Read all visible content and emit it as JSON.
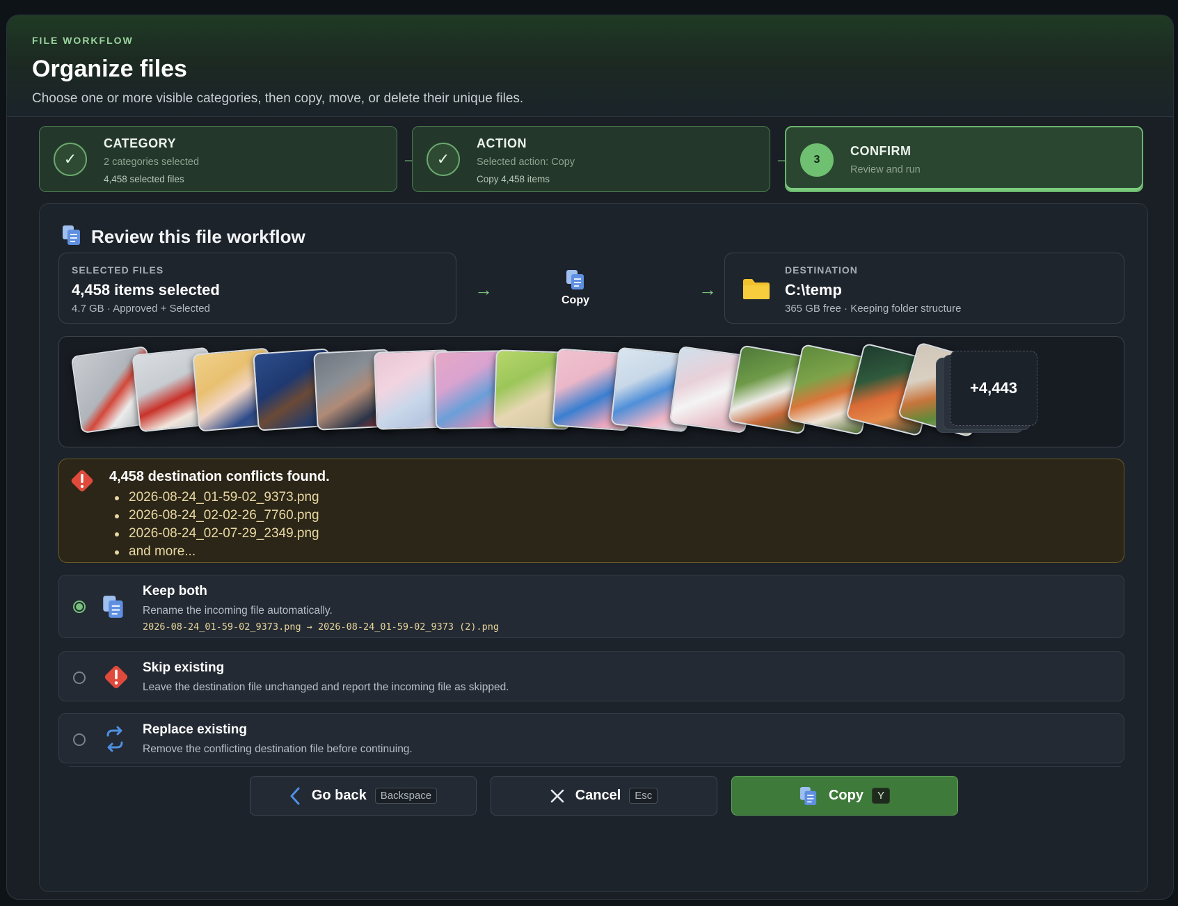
{
  "header": {
    "eyebrow": "FILE WORKFLOW",
    "title": "Organize files",
    "subtitle": "Choose one or more visible categories, then copy, move, or delete their unique files."
  },
  "steps": [
    {
      "title": "CATEGORY",
      "line1": "2 categories selected",
      "line2": "4,458 selected files",
      "marker": "✓",
      "state": "done"
    },
    {
      "title": "ACTION",
      "line1": "Selected action: Copy",
      "line2": "Copy 4,458 items",
      "marker": "✓",
      "state": "done"
    },
    {
      "title": "CONFIRM",
      "line1": "Review and run",
      "marker": "3",
      "state": "active"
    }
  ],
  "review": {
    "heading": "Review this file workflow",
    "selected": {
      "label": "SELECTED FILES",
      "value": "4,458 items selected",
      "meta": "4.7 GB · Approved + Selected"
    },
    "action": {
      "label": "Copy",
      "icon": "copy-icon"
    },
    "destination": {
      "label": "DESTINATION",
      "value": "C:\\temp",
      "meta": "365 GB free · Keeping folder structure",
      "icon": "folder-icon"
    },
    "more_count": "+4,443"
  },
  "conflicts": {
    "heading": "4,458 destination conflicts found.",
    "items": [
      "2026-08-24_01-59-02_9373.png",
      "2026-08-24_02-02-26_7760.png",
      "2026-08-24_02-07-29_2349.png",
      "and more..."
    ]
  },
  "options": [
    {
      "title": "Keep both",
      "desc": "Rename the incoming file automatically.",
      "example": "2026-08-24_01-59-02_9373.png → 2026-08-24_01-59-02_9373 (2).png",
      "selected": true,
      "icon": "copy-icon"
    },
    {
      "title": "Skip existing",
      "desc": "Leave the destination file unchanged and report the incoming file as skipped.",
      "selected": false,
      "icon": "warning-icon"
    },
    {
      "title": "Replace existing",
      "desc": "Remove the conflicting destination file before continuing.",
      "selected": false,
      "icon": "replace-icon"
    }
  ],
  "buttons": {
    "back": {
      "label": "Go back",
      "key": "Backspace"
    },
    "cancel": {
      "label": "Cancel",
      "key": "Esc"
    },
    "copy": {
      "label": "Copy",
      "key": "Y"
    }
  },
  "colors": {
    "accent": "#6fc071",
    "warning": "#e04a3c",
    "primary_button": "#3e7a3a",
    "icon_blue": "#5f8fe0",
    "folder": "#f2c12e"
  }
}
